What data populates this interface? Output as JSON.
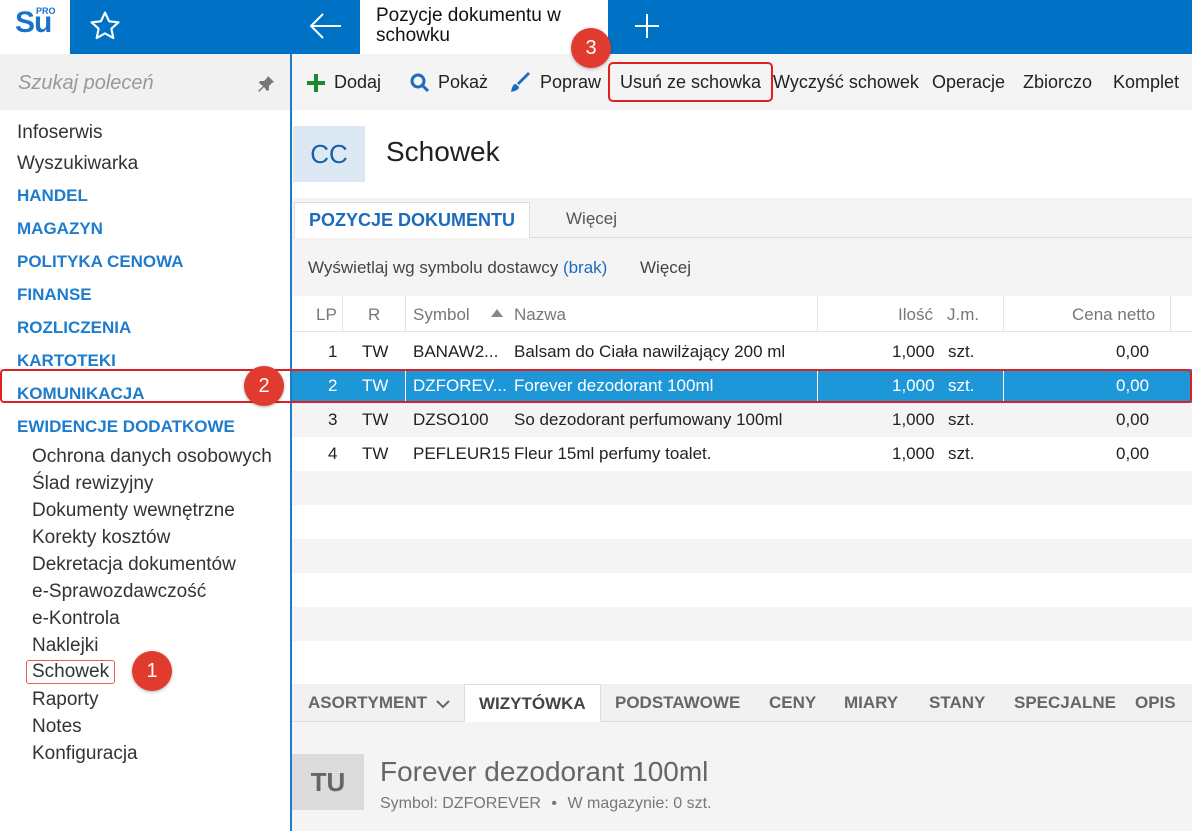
{
  "app": {
    "logo_text": "Su",
    "logo_sup": "PRO",
    "tab_title": "Pozycje dokumentu w schowku"
  },
  "sidebar": {
    "search_placeholder": "Szukaj poleceń",
    "top_items": [
      "Infoserwis",
      "Wyszukiwarka"
    ],
    "sections": [
      "HANDEL",
      "MAGAZYN",
      "POLITYKA CENOWA",
      "FINANSE",
      "ROZLICZENIA",
      "KARTOTEKI",
      "KOMUNIKACJA",
      "EWIDENCJE DODATKOWE"
    ],
    "sub_items": [
      "Ochrona danych osobowych",
      "Ślad rewizyjny",
      "Dokumenty wewnętrzne",
      "Korekty kosztów",
      "Dekretacja dokumentów",
      "e-Sprawozdawczość",
      "e-Kontrola",
      "Naklejki",
      "Schowek",
      "Raporty",
      "Notes",
      "Konfiguracja"
    ]
  },
  "toolbar": {
    "dodaj": "Dodaj",
    "pokaz": "Pokaż",
    "popraw": "Popraw",
    "usun": "Usuń ze schowka",
    "wyczysc": "Wyczyść schowek",
    "operacje": "Operacje",
    "zbiorczo": "Zbiorczo",
    "komplet": "Komplet"
  },
  "header": {
    "tile": "CC",
    "title": "Schowek"
  },
  "tabs": {
    "active": "POZYCJE DOKUMENTU",
    "more": "Więcej"
  },
  "filter": {
    "label": "Wyświetlaj wg symbolu dostawcy",
    "link": "(brak)",
    "more": "Więcej"
  },
  "grid": {
    "columns": [
      "LP",
      "R",
      "Symbol",
      "Nazwa",
      "Ilość",
      "J.m.",
      "Cena netto"
    ],
    "rows": [
      {
        "lp": "1",
        "r": "TW",
        "symbol": "BANAW2...",
        "nazwa": "Balsam do Ciała nawilżający 200 ml",
        "ilosc": "1,000",
        "jm": "szt.",
        "cena": "0,00"
      },
      {
        "lp": "2",
        "r": "TW",
        "symbol": "DZFOREV...",
        "nazwa": "Forever dezodorant 100ml",
        "ilosc": "1,000",
        "jm": "szt.",
        "cena": "0,00"
      },
      {
        "lp": "3",
        "r": "TW",
        "symbol": "DZSO100",
        "nazwa": "So dezodorant perfumowany 100ml",
        "ilosc": "1,000",
        "jm": "szt.",
        "cena": "0,00"
      },
      {
        "lp": "4",
        "r": "TW",
        "symbol": "PEFLEUR15",
        "nazwa": "Fleur 15ml perfumy toalet.",
        "ilosc": "1,000",
        "jm": "szt.",
        "cena": "0,00"
      }
    ]
  },
  "bottom_tabs": [
    "ASORTYMENT",
    "WIZYTÓWKA",
    "PODSTAWOWE",
    "CENY",
    "MIARY",
    "STANY",
    "SPECJALNE",
    "OPIS"
  ],
  "detail": {
    "tile": "TU",
    "title": "Forever dezodorant 100ml",
    "symbol": "Symbol: DZFOREVER",
    "sep": "•",
    "stock": "W magazynie: 0 szt."
  },
  "badges": [
    "1",
    "2",
    "3"
  ],
  "colors": {
    "accent": "#0072c6",
    "selection": "#1e97d8",
    "badge": "#e13a2e"
  }
}
